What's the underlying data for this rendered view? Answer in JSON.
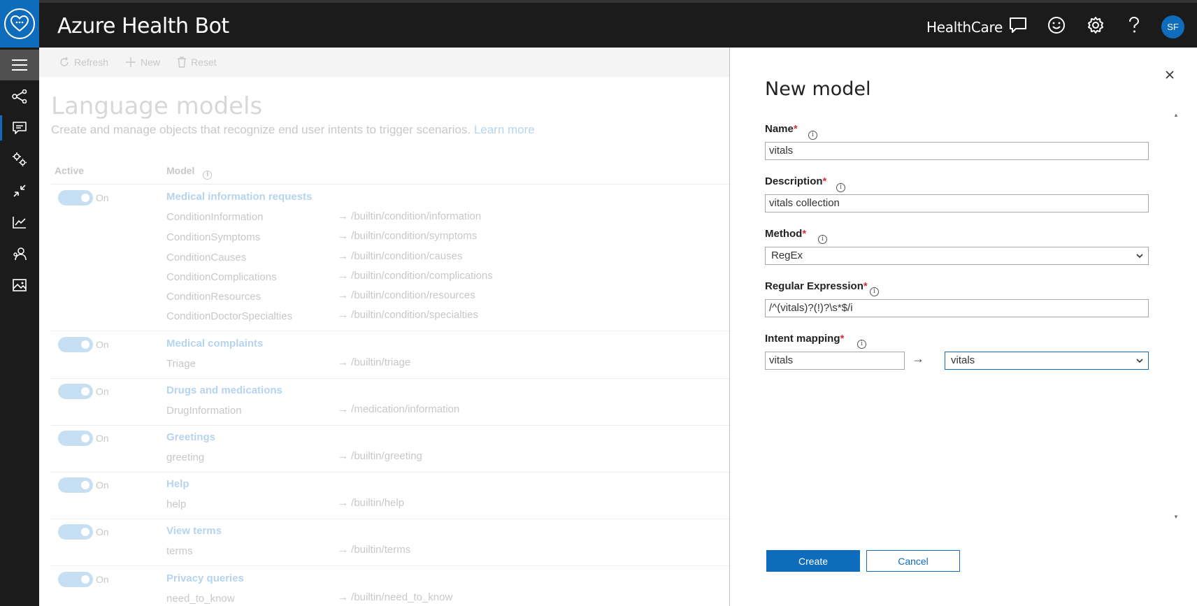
{
  "app": {
    "title": "Azure Health Bot",
    "tenant": "HealthCare",
    "avatar_initials": "SF"
  },
  "topbar_icons": [
    "chat-icon",
    "smiley-icon",
    "gear-icon",
    "help-icon"
  ],
  "rail_icons": [
    "hamburger-menu-icon",
    "scenarios-icon",
    "language-icon",
    "integration-icon",
    "resize-icon",
    "analytics-icon",
    "users-icon",
    "image-icon"
  ],
  "toolbar": {
    "refresh": "Refresh",
    "new": "New",
    "reset": "Reset"
  },
  "page": {
    "title": "Language models",
    "subtitle": "Create and manage objects that recognize end user intents to trigger scenarios.",
    "learn_more": "Learn more",
    "col_active": "Active",
    "col_model": "Model"
  },
  "groups": [
    {
      "toggle": "On",
      "name": "Medical information requests",
      "intents": [
        {
          "intent": "ConditionInformation",
          "route": "→ /builtin/condition/information"
        },
        {
          "intent": "ConditionSymptoms",
          "route": "→ /builtin/condition/symptoms"
        },
        {
          "intent": "ConditionCauses",
          "route": "→ /builtin/condition/causes"
        },
        {
          "intent": "ConditionComplications",
          "route": "→ /builtin/condition/complications"
        },
        {
          "intent": "ConditionResources",
          "route": "→ /builtin/condition/resources"
        },
        {
          "intent": "ConditionDoctorSpecialties",
          "route": "→ /builtin/condition/specialties"
        }
      ]
    },
    {
      "toggle": "On",
      "name": "Medical complaints",
      "intents": [
        {
          "intent": "Triage",
          "route": "→ /builtin/triage"
        }
      ]
    },
    {
      "toggle": "On",
      "name": "Drugs and medications",
      "intents": [
        {
          "intent": "DrugInformation",
          "route": "→ /medication/information"
        }
      ]
    },
    {
      "toggle": "On",
      "name": "Greetings",
      "intents": [
        {
          "intent": "greeting",
          "route": "→ /builtin/greeting"
        }
      ]
    },
    {
      "toggle": "On",
      "name": "Help",
      "intents": [
        {
          "intent": "help",
          "route": "→ /builtin/help"
        }
      ]
    },
    {
      "toggle": "On",
      "name": "View terms",
      "intents": [
        {
          "intent": "terms",
          "route": "→ /builtin/terms"
        }
      ]
    },
    {
      "toggle": "On",
      "name": "Privacy queries",
      "intents": [
        {
          "intent": "need_to_know",
          "route": "→ /builtin/need_to_know"
        }
      ]
    }
  ],
  "panel": {
    "title": "New model",
    "required_mark": "*",
    "name_label": "Name",
    "name_value": "vitals",
    "description_label": "Description",
    "description_value": "vitals collection",
    "method_label": "Method",
    "method_value": "RegEx",
    "regex_label": "Regular Expression",
    "regex_value": "/^(vitals)?(!)?\\s*$/i",
    "intent_label": "Intent mapping",
    "intent_value": "vitals",
    "intent_target": "vitals",
    "arrow": "→",
    "create": "Create",
    "cancel": "Cancel"
  },
  "colors": {
    "accent": "#0f6cbd",
    "required": "#d13438",
    "topbar": "#1b1b1b"
  }
}
